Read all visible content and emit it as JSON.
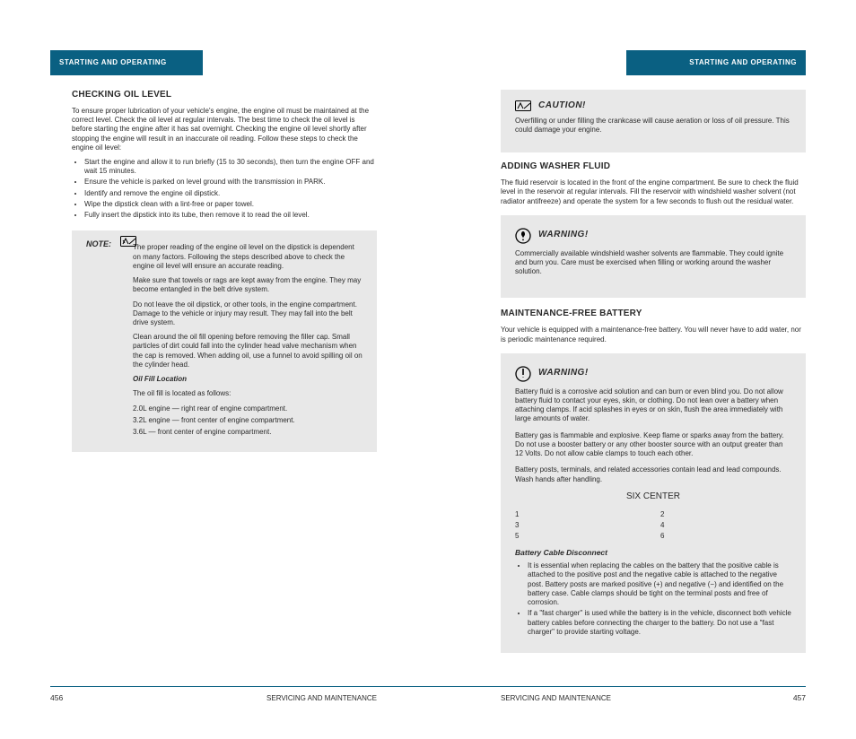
{
  "header": {
    "left_label": "STARTING AND OPERATING",
    "right_label": "STARTING AND OPERATING"
  },
  "left_column": {
    "title": "CHECKING OIL LEVEL",
    "p1": "To ensure proper lubrication of your vehicle's engine, the engine oil must be maintained at the correct level. Check the oil level at regular intervals. The best time to check the oil level is before starting the engine after it has sat overnight. Checking the engine oil level shortly after stopping the engine will result in an inaccurate oil reading. Follow these steps to check the engine oil level:",
    "steps": [
      "Start the engine and allow it to run briefly (15 to 30 seconds), then turn the engine OFF and wait 15 minutes.",
      "Ensure the vehicle is parked on level ground with the transmission in PARK.",
      "Identify and remove the engine oil dipstick.",
      "Wipe the dipstick clean with a lint-free or paper towel.",
      "Fully insert the dipstick into its tube, then remove it to read the oil level."
    ],
    "note": {
      "label": "NOTE:",
      "paragraphs": [
        "The proper reading of the engine oil level on the dipstick is dependent on many factors. Following the steps described above to check the engine oil level will ensure an accurate reading.",
        "Make sure that towels or rags are kept away from the engine. They may become entangled in the belt drive system.",
        "Do not leave the oil dipstick, or other tools, in the engine compartment. Damage to the vehicle or injury may result. They may fall into the belt drive system."
      ],
      "p4": "Clean around the oil fill opening before removing the filler cap. Small particles of dirt could fall into the cylinder head valve mechanism when the cap is removed. When adding oil, use a funnel to avoid spilling oil on the cylinder head.",
      "oil_fill_title": "Oil Fill Location",
      "engine_list_label": "The oil fill is located as follows:",
      "engine_list": [
        "2.0L engine — right rear of engine compartment.",
        "3.2L engine — front center of engine compartment.",
        "3.6L — front center of engine compartment."
      ]
    }
  },
  "right_column": {
    "caution": {
      "label": "CAUTION!",
      "p1": "Overfilling or under filling the crankcase will cause aeration or loss of oil pressure. This could damage your engine."
    },
    "section2_title": "ADDING WASHER FLUID",
    "section2_p1": "The fluid reservoir is located in the front of the engine compartment. Be sure to check the fluid level in the reservoir at regular intervals. Fill the reservoir with windshield washer solvent (not radiator antifreeze) and operate the system for a few seconds to flush out the residual water.",
    "warning": {
      "label": "WARNING!",
      "p1": "Commercially available windshield washer solvents are flammable. They could ignite and burn you. Care must be exercised when filling or working around the washer solution."
    },
    "section3_title": "MAINTENANCE-FREE BATTERY",
    "section3_p1": "Your vehicle is equipped with a maintenance-free battery. You will never have to add water, nor is periodic maintenance required.",
    "warning2": {
      "label": "WARNING!",
      "para": "Battery fluid is a corrosive acid solution and can burn or even blind you. Do not allow battery fluid to contact your eyes, skin, or clothing. Do not lean over a battery when attaching clamps. If acid splashes in eyes or on skin, flush the area immediately with large amounts of water.",
      "para2": "Battery gas is flammable and explosive. Keep flame or sparks away from the battery. Do not use a booster battery or any other booster source with an output greater than 12 Volts. Do not allow cable clamps to touch each other.",
      "para3": "Battery posts, terminals, and related accessories contain lead and lead compounds. Wash hands after handling.",
      "six_title": "SIX CENTER",
      "six_items": [
        "1",
        "2",
        "3",
        "4",
        "5",
        "6"
      ],
      "sub_title": "Battery Cable Disconnect",
      "sub_bullets": [
        "It is essential when replacing the cables on the battery that the positive cable is attached to the positive post and the negative cable is attached to the negative post. Battery posts are marked positive (+) and negative (−) and identified on the battery case. Cable clamps should be tight on the terminal posts and free of corrosion.",
        "If a \"fast charger\" is used while the battery is in the vehicle, disconnect both vehicle battery cables before connecting the charger to the battery. Do not use a \"fast charger\" to provide starting voltage."
      ]
    }
  },
  "footer": {
    "page_left": "456",
    "page_right": "457",
    "title_left": "SERVICING AND MAINTENANCE",
    "title_right": "SERVICING AND MAINTENANCE"
  }
}
